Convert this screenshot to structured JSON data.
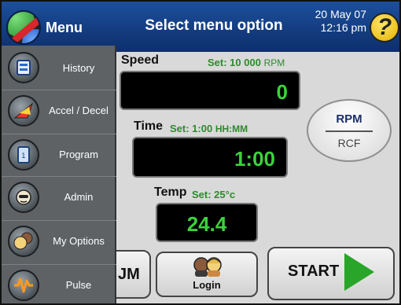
{
  "header": {
    "menu_label": "Menu",
    "title": "Select menu option",
    "date": "20 May 07",
    "time": "12:16 pm",
    "help_glyph": "?"
  },
  "sidebar": {
    "items": [
      {
        "label": "History",
        "icon": "history-icon"
      },
      {
        "label": "Accel / Decel",
        "icon": "accel-decel-icon"
      },
      {
        "label": "Program",
        "icon": "program-icon"
      },
      {
        "label": "Admin",
        "icon": "admin-icon"
      },
      {
        "label": "My Options",
        "icon": "my-options-icon"
      },
      {
        "label": "Pulse",
        "icon": "pulse-icon"
      }
    ]
  },
  "speed": {
    "label": "Speed",
    "set_label": "Set: 10 000",
    "set_unit": "RPM",
    "value": "0"
  },
  "time": {
    "label": "Time",
    "set_label": "Set:  1:00",
    "set_unit": "HH:MM",
    "value": "1:00"
  },
  "temp": {
    "label": "Temp",
    "set_label": "Set: 25°c",
    "value": "24.4"
  },
  "unit_toggle": {
    "top": "RPM",
    "bottom": "RCF"
  },
  "buttons": {
    "partial": "JM",
    "login": "Login",
    "start": "START"
  },
  "colors": {
    "header": "#1c4f9c",
    "display_text": "#3cd23c",
    "set_text": "#2d8a2d",
    "start_arrow": "#29a529"
  }
}
